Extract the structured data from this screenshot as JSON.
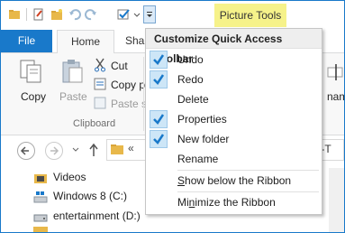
{
  "contextual_tab": "Picture Tools",
  "tabs": {
    "file": "File",
    "home": "Home",
    "share": "Shar"
  },
  "ribbon": {
    "copy": "Copy",
    "paste": "Paste",
    "cut": "Cut",
    "copy_path": "Copy pa",
    "paste_shortcut": "Paste sh",
    "clipboard_group": "Clipboard",
    "rename_partial": "name"
  },
  "menu": {
    "title": "Customize Quick Access Toolbar",
    "items": [
      {
        "label": "Undo",
        "checked": true
      },
      {
        "label": "Redo",
        "checked": true
      },
      {
        "label": "Delete",
        "checked": false
      },
      {
        "label": "Properties",
        "checked": true
      },
      {
        "label": "New folder",
        "checked": true
      },
      {
        "label": "Rename",
        "checked": false
      }
    ],
    "show_below": {
      "prefix": "",
      "mnemonic": "S",
      "rest": "how below the Ribbon"
    },
    "minimize": {
      "prefix": "Mi",
      "mnemonic": "n",
      "rest": "imize the Ribbon"
    }
  },
  "address": {
    "overflow": "«",
    "right_text": "ow-T"
  },
  "tree": [
    {
      "label": "Videos",
      "icon": "video-folder-icon"
    },
    {
      "label": "Windows 8 (C:)",
      "icon": "windows-drive-icon"
    },
    {
      "label": "entertainment (D:)",
      "icon": "drive-icon"
    }
  ],
  "colors": {
    "accent": "#1979ca",
    "picture_tools": "#f6f28a",
    "check": "#1979ca"
  }
}
